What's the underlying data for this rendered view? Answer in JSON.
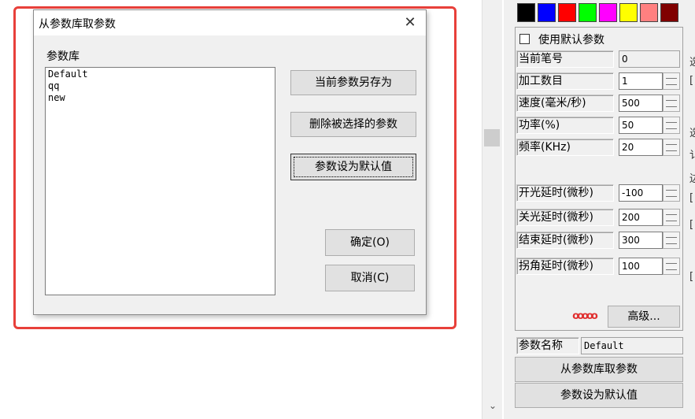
{
  "dialog": {
    "title": "从参数库取参数",
    "close_glyph": "✕",
    "library_label": "参数库",
    "library_items": [
      "Default",
      "qq",
      "new"
    ],
    "buttons": {
      "save_as": "当前参数另存为",
      "delete": "删除被选择的参数",
      "set_default": "参数设为默认值",
      "ok": "确定(O)",
      "cancel": "取消(C)"
    }
  },
  "panel": {
    "colors": [
      "#000000",
      "#0000ff",
      "#ff0000",
      "#00ff00",
      "#ff00ff",
      "#ffff00",
      "#ff8080",
      "#800000"
    ],
    "use_default_label": "使用默认参数",
    "use_default_checked": false,
    "fields": {
      "current_pen": {
        "label": "当前笔号",
        "value": "0"
      },
      "process_count": {
        "label": "加工数目",
        "value": "1"
      },
      "speed": {
        "label": "速度(毫米/秒)",
        "value": "500"
      },
      "power": {
        "label": "功率(%)",
        "value": "50"
      },
      "frequency": {
        "label": "频率(KHz)",
        "value": "20"
      },
      "on_delay": {
        "label": "开光延时(微秒)",
        "value": "-100"
      },
      "off_delay": {
        "label": "关光延时(微秒)",
        "value": "200"
      },
      "end_delay": {
        "label": "结束延时(微秒)",
        "value": "300"
      },
      "corner_delay": {
        "label": "拐角延时(微秒)",
        "value": "100"
      }
    },
    "ring_icon": "ooooo",
    "advanced_label": "高级...",
    "param_name_label": "参数名称",
    "param_name_value": "Default",
    "load_from_lib": "从参数库取参数",
    "set_as_default": "参数设为默认值"
  },
  "scrollbar": {
    "down_glyph": "⌄"
  },
  "edge_glyphs": [
    "选",
    "[",
    "选",
    "讠",
    "边",
    "[",
    "[",
    "[",
    "[",
    "[",
    "[",
    "[",
    "[",
    "[",
    "[",
    "[",
    "[",
    "[",
    "[",
    "[",
    "[",
    "[",
    "[",
    "[",
    "[",
    "[",
    "[",
    "[",
    "[",
    "[",
    "[",
    "[",
    "["
  ]
}
